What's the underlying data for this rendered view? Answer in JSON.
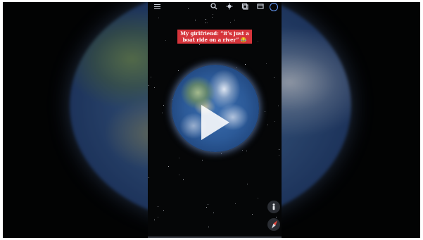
{
  "video": {
    "caption": "My girlfriend: “it’s just a boat ride on a river” 😂"
  },
  "toolbar": {
    "icons": [
      "menu-icon",
      "search-icon",
      "voyager-icon",
      "layers-icon",
      "projects-icon",
      "account-icon"
    ]
  },
  "map_controls": {
    "pegman_icon": "street-view-icon",
    "compass_icon": "compass-icon"
  },
  "colors": {
    "caption_bg": "#d6343b",
    "account_accent": "#6aa0ff"
  }
}
